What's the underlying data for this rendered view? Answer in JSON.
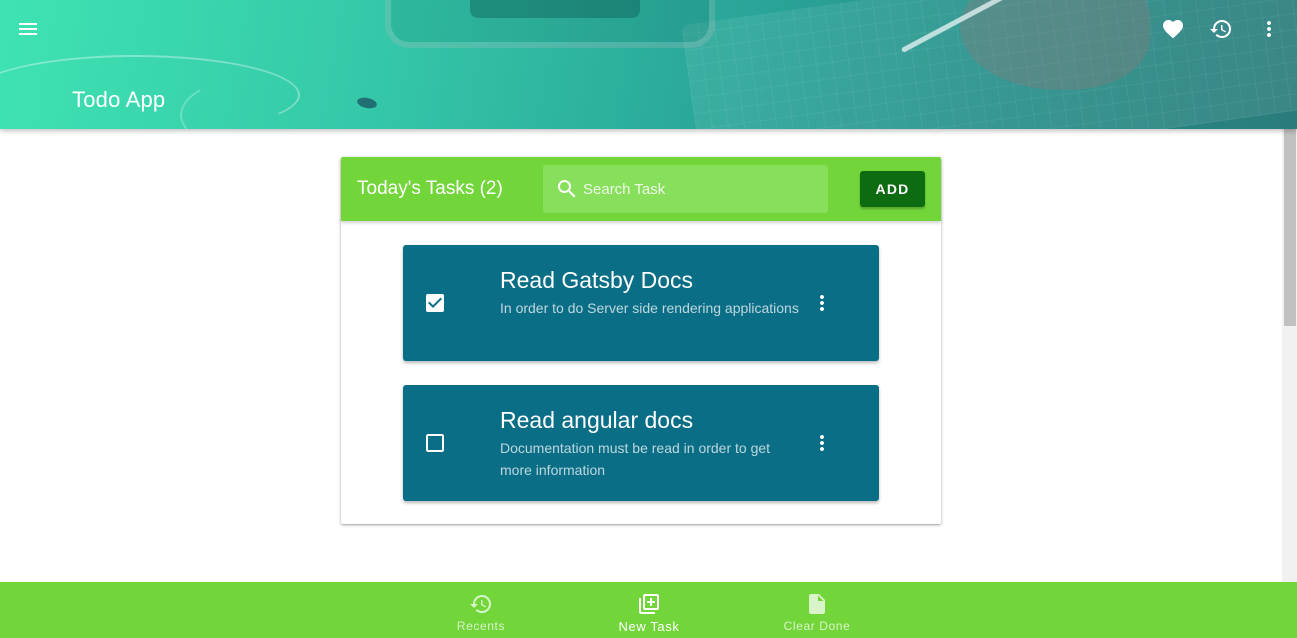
{
  "app": {
    "title": "Todo App",
    "icons": {
      "menu": "menu-icon",
      "favorite": "heart-icon",
      "history": "history-icon",
      "more": "more-vert-icon"
    }
  },
  "tasks_card": {
    "title": "Today's Tasks (2)",
    "search": {
      "placeholder": "Search Task",
      "value": ""
    },
    "add_label": "ADD",
    "header_color": "#72d63a",
    "button_color": "#0d6b12",
    "items": [
      {
        "title": "Read Gatsby Docs",
        "description": "In order to do Server side rendering applications",
        "done": true
      },
      {
        "title": "Read angular docs",
        "description": "Documentation must be read in order to get more information",
        "done": false
      }
    ],
    "item_color": "#0b6e87"
  },
  "bottom_nav": {
    "items": [
      {
        "label": "Recents",
        "icon": "history-icon",
        "active": false
      },
      {
        "label": "New Task",
        "icon": "library-add-icon",
        "active": true
      },
      {
        "label": "Clear Done",
        "icon": "note-icon",
        "active": false
      }
    ],
    "color": "#72d63a"
  }
}
